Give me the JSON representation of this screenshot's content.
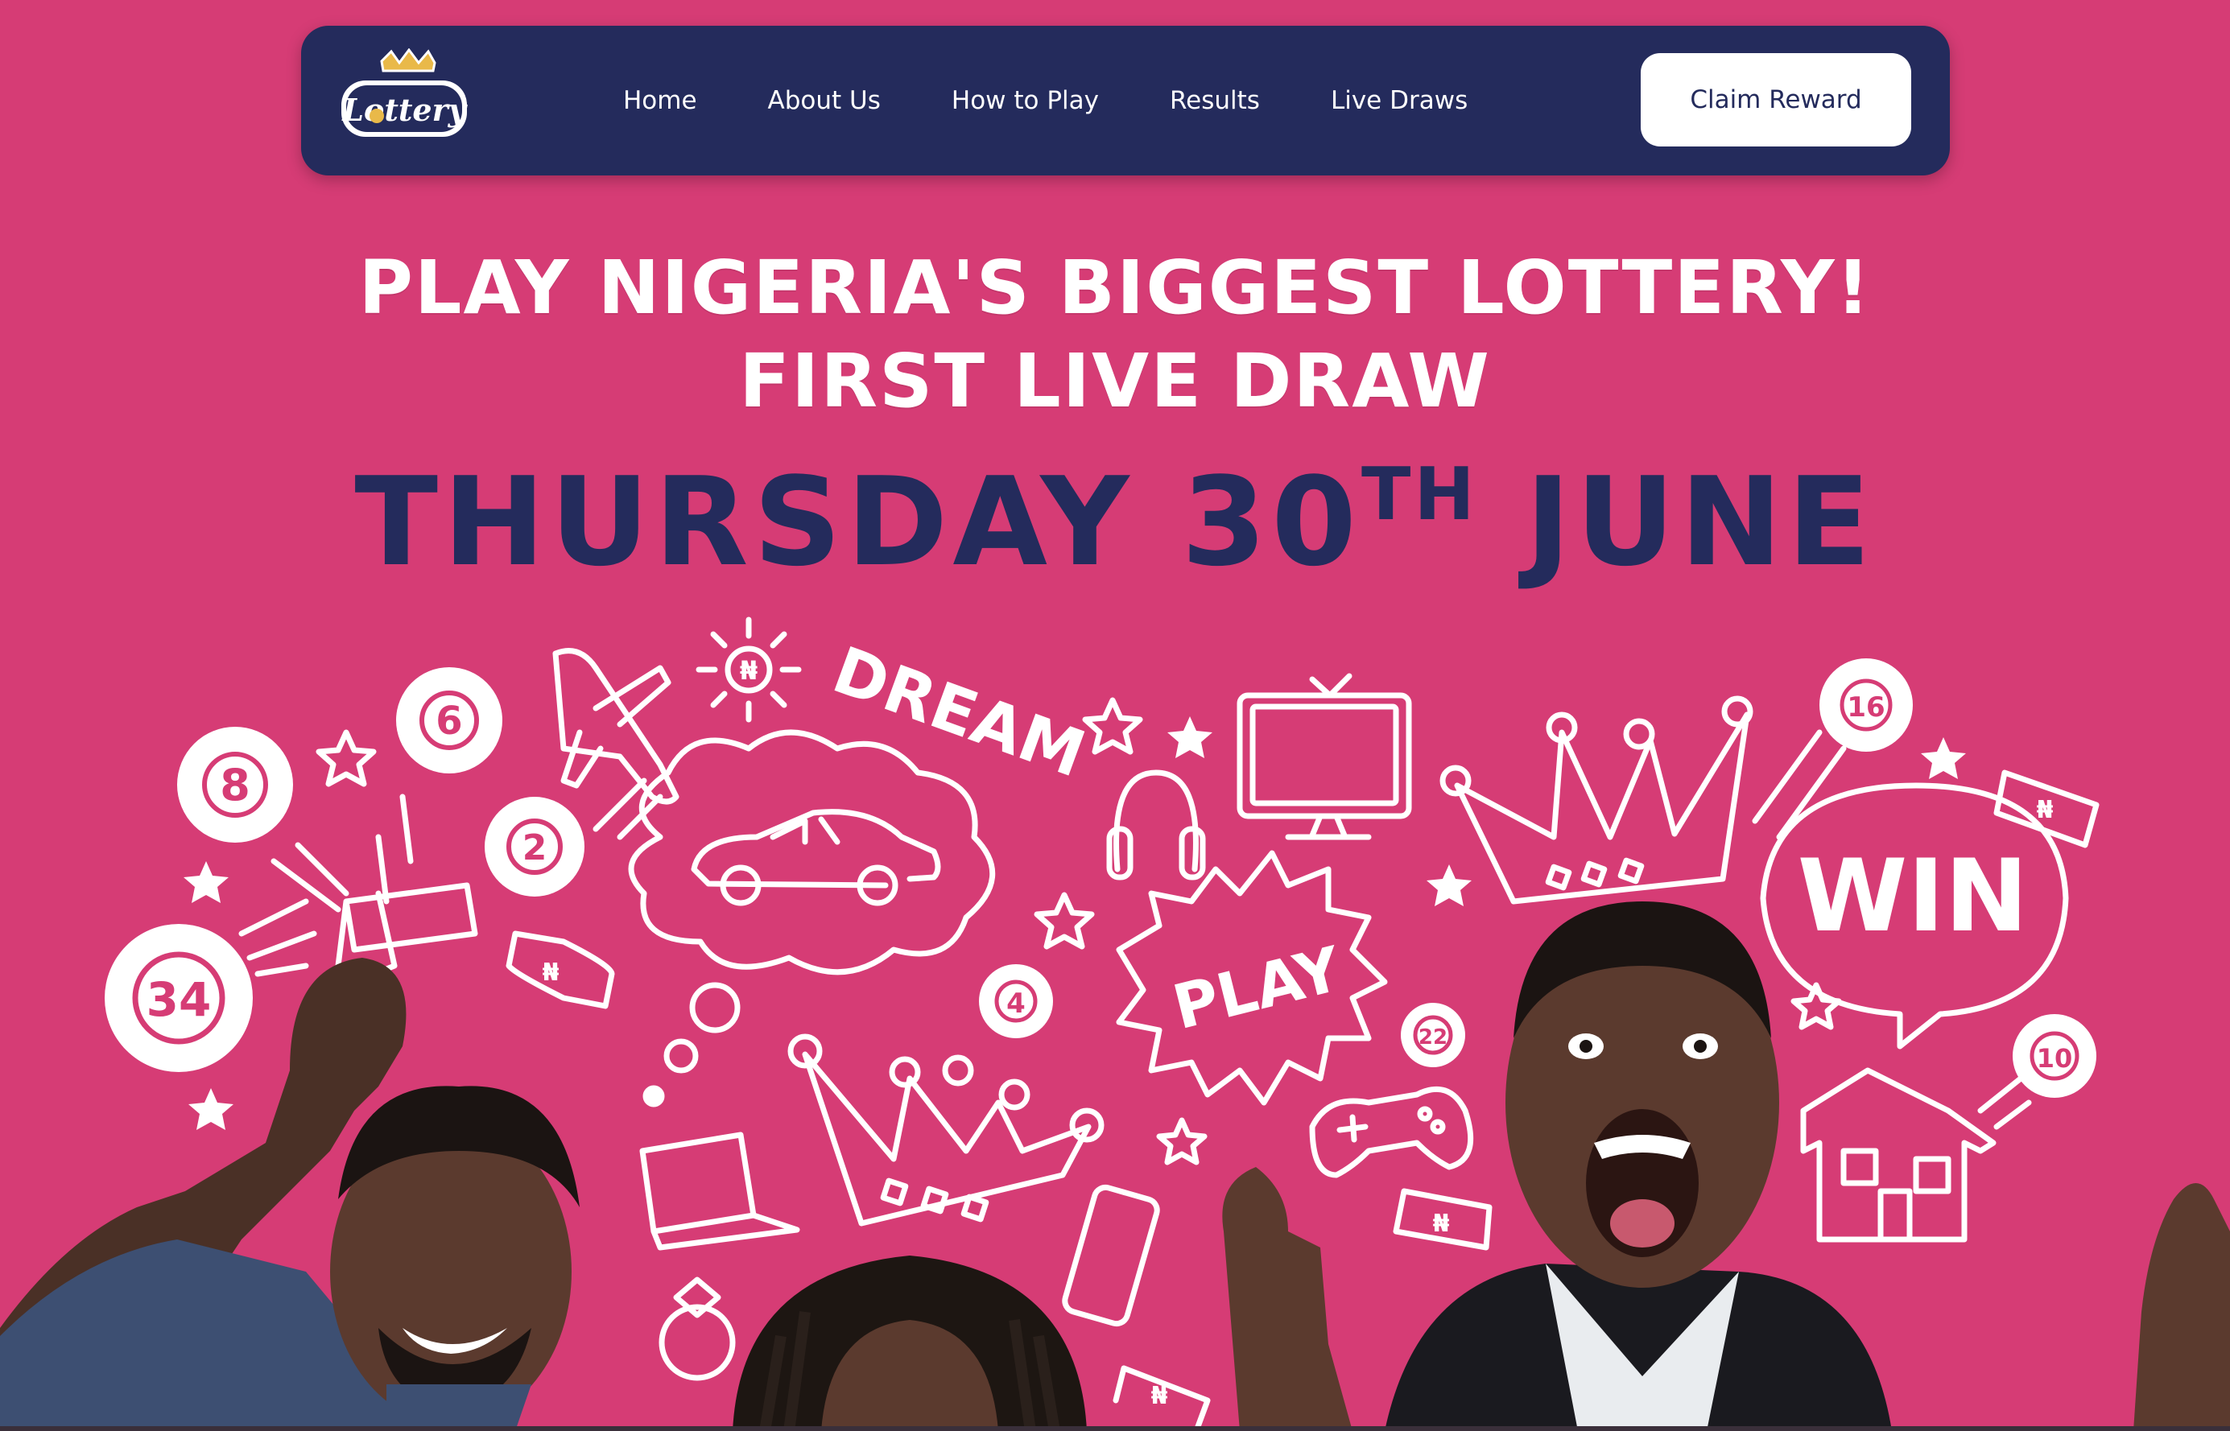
{
  "nav": {
    "logo_text": "Lottery",
    "links": [
      {
        "label": "Home"
      },
      {
        "label": "About Us"
      },
      {
        "label": "How to Play"
      },
      {
        "label": "Results"
      },
      {
        "label": "Live Draws"
      }
    ],
    "cta_label": "Claim Reward"
  },
  "hero": {
    "line1": "PLAY NIGERIA'S BIGGEST LOTTERY!",
    "line2": "FIRST LIVE DRAW",
    "date_main": "THURSDAY 30",
    "date_suffix": "TH",
    "date_month": " JUNE"
  },
  "illustration": {
    "balls": [
      "8",
      "6",
      "2",
      "34",
      "4",
      "22",
      "16",
      "10"
    ],
    "words": {
      "dream": "DREAM",
      "play": "PLAY",
      "win": "WIN"
    },
    "currency_symbol": "₦"
  },
  "colors": {
    "background": "#d63c75",
    "navbar": "#242b5c",
    "accent_text": "#242b5c",
    "white": "#ffffff"
  }
}
